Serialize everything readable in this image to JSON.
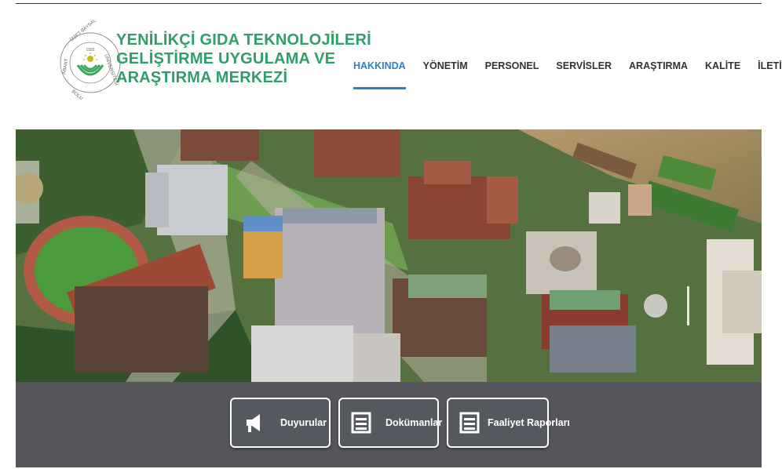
{
  "header": {
    "logo": {
      "ring_text": "İZZET BAYSAL · ÜNİVERSİTESİ · BOLU ABANT",
      "year": "1992"
    },
    "title_lines": [
      "YENİLİKÇİ GIDA TEKNOLOJİLERİ",
      "GELİŞTİRME UYGULAMA VE",
      "ARAŞTIRMA MERKEZİ"
    ]
  },
  "nav": {
    "items": [
      {
        "label": "HAKKINDA",
        "active": true
      },
      {
        "label": "YÖNETİM",
        "active": false
      },
      {
        "label": "PERSONEL",
        "active": false
      },
      {
        "label": "SERVİSLER",
        "active": false
      },
      {
        "label": "ARAŞTIRMA",
        "active": false
      },
      {
        "label": "KALİTE",
        "active": false
      },
      {
        "label": "İLETİŞİM",
        "active": false
      }
    ]
  },
  "hero": {
    "description_icon": "campus-aerial-photo"
  },
  "actions": [
    {
      "label": "Duyurular",
      "icon": "megaphone-icon"
    },
    {
      "label": "Dokümanlar",
      "icon": "document-icon"
    },
    {
      "label": "Faaliyet Raporları",
      "icon": "report-icon"
    }
  ],
  "colors": {
    "brand_green": "#2e9e6b",
    "nav_active": "#2a7fd0",
    "bar_bg": "#54565c"
  }
}
